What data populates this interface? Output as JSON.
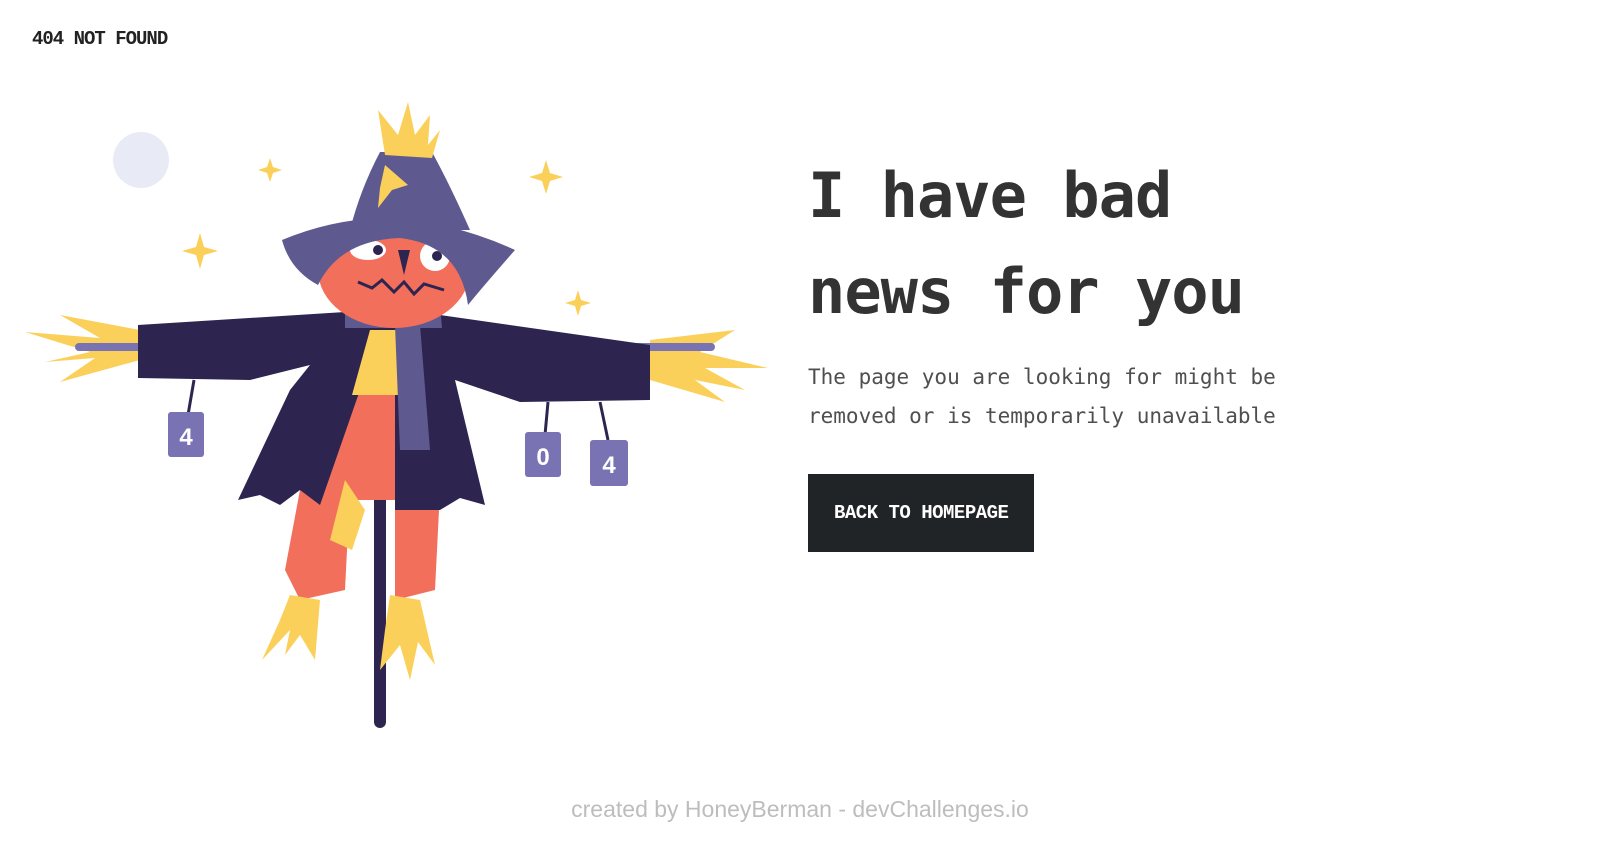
{
  "header": {
    "brand": "404 NOT FOUND"
  },
  "illustration": {
    "cans": [
      "4",
      "0",
      "4"
    ]
  },
  "main": {
    "headline_lines": [
      "I have bad",
      "news for you"
    ],
    "message": "The page you are looking for might be removed or is temporarily unavailable",
    "button_label": "BACK TO HOMEPAGE"
  },
  "footer": {
    "credit": "created by HoneyBerman - devChallenges.io"
  },
  "colors": {
    "text_dark": "#333333",
    "button_bg": "#202427",
    "button_text": "#ffffff",
    "footer_text": "#bdbdbd",
    "hat": "#5e5a8f",
    "coat": "#2d2550",
    "pumpkin": "#f26f5c",
    "straw": "#fbd05a",
    "moon": "#e8ebf6"
  }
}
